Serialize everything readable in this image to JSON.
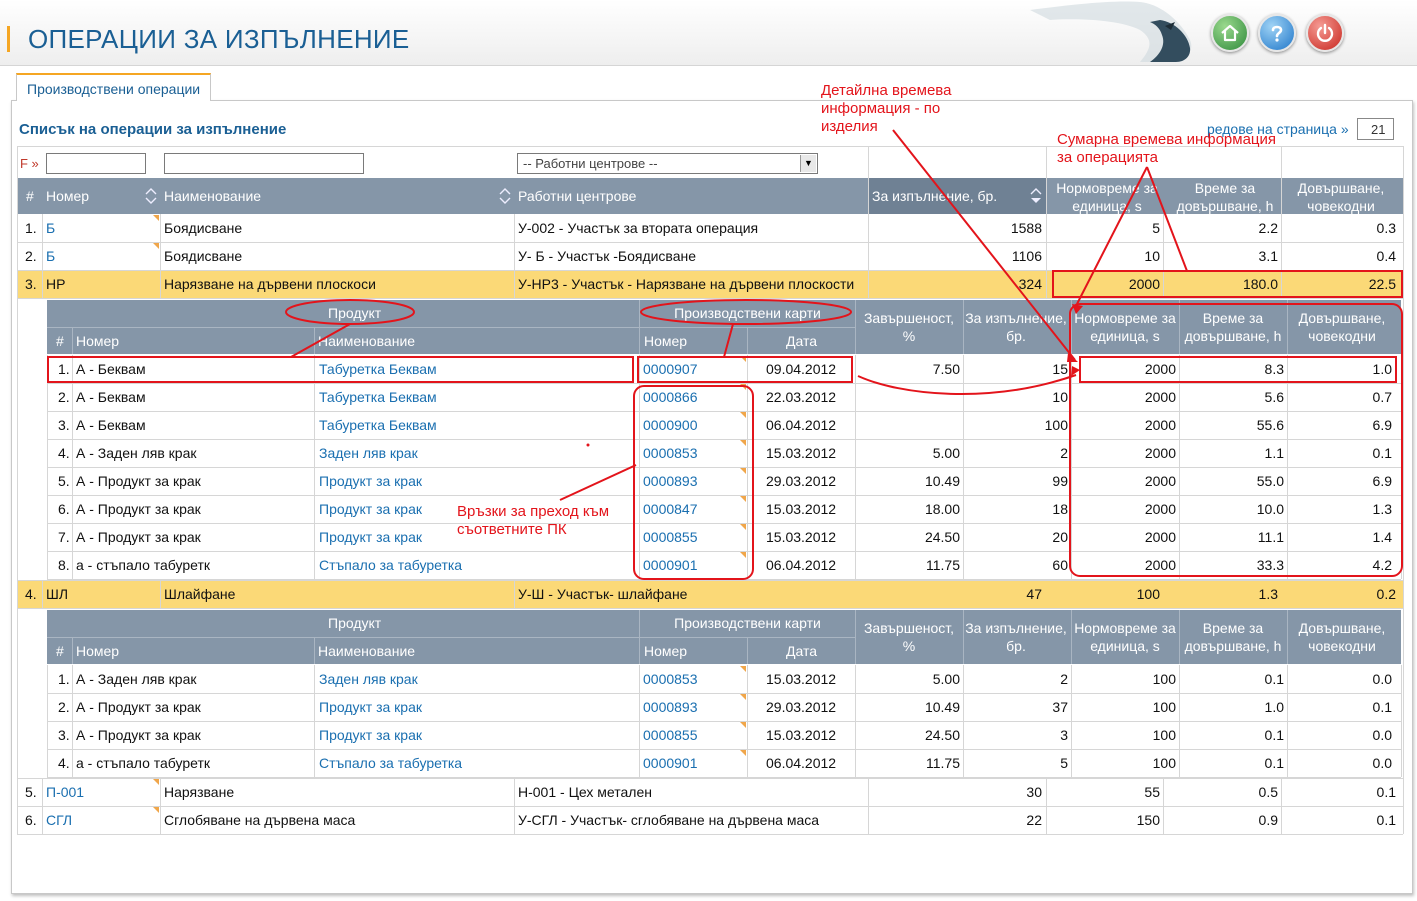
{
  "header": {
    "title": "ОПЕРАЦИИ ЗА ИЗПЪЛНЕНИЕ",
    "buttons": {
      "home": "home-icon",
      "help": "help-icon",
      "power": "power-icon"
    }
  },
  "tab": {
    "label": "Производствени операции"
  },
  "list": {
    "title": "Списък на операции за изпълнение",
    "rows_per_page_label": "редове на страница »",
    "rows_per_page_value": "21"
  },
  "filters": {
    "label": "F »",
    "number_value": "",
    "name_value": "",
    "work_center_selected": "-- Работни центрове --"
  },
  "main_columns": {
    "num": "#",
    "number": "Номер",
    "name": "Наименование",
    "work_centers": "Работни центрове",
    "to_execute": "За изпълнение, бр.",
    "norm_time": "Нормовреме за единица, s",
    "time_to_finish": "Време за довършване, h",
    "finish_mandays": "Довършване, човекодни"
  },
  "sub_columns": {
    "product": "Продукт",
    "production_cards": "Производствени карти",
    "num": "#",
    "number": "Номер",
    "name": "Наименование",
    "card_number": "Номер",
    "date": "Дата",
    "completion": "Завършеност, %",
    "to_execute": "За изпълнение, бр.",
    "norm_time": "Нормовреме за единица, s",
    "time_to_finish": "Време за довършване, h",
    "finish_mandays": "Довършване, човекодни"
  },
  "operations": [
    {
      "idx": "1.",
      "number": "Б",
      "name": "Боядисване",
      "work_center": "У-002 - Участък за втората операция",
      "to_execute": "1588",
      "norm": "5",
      "time": "2.2",
      "days": "0.3"
    },
    {
      "idx": "2.",
      "number": "Б",
      "name": "Боядисване",
      "work_center": "У- Б - Участък -Боядисване",
      "to_execute": "1106",
      "norm": "10",
      "time": "3.1",
      "days": "0.4"
    },
    {
      "idx": "3.",
      "number": "НР",
      "name": "Нарязване на дървени плоскоси",
      "work_center": "У-НР3 - Участък - Нарязване на дървени плоскости",
      "to_execute": "324",
      "norm": "2000",
      "time": "180.0",
      "days": "22.5"
    },
    {
      "idx": "4.",
      "number": "ШЛ",
      "name": "Шлайфане",
      "work_center": "У-Ш - Участък- шлайфане",
      "to_execute": "47",
      "norm": "100",
      "time": "1.3",
      "days": "0.2"
    },
    {
      "idx": "5.",
      "number": "П-001",
      "name": "Нарязване",
      "work_center": "Н-001 - Цех метален",
      "to_execute": "30",
      "norm": "55",
      "time": "0.5",
      "days": "0.1"
    },
    {
      "idx": "6.",
      "number": "СГЛ",
      "name": "Сглобяване на дървена маса",
      "work_center": "У-СГЛ - Участък- сглобяване на дървена маса",
      "to_execute": "22",
      "norm": "150",
      "time": "0.9",
      "days": "0.1"
    }
  ],
  "details_op3": [
    {
      "idx": "1.",
      "product_no": "А - Беквам",
      "product_name": "Табуретка Беквам",
      "card": "0000907",
      "date": "09.04.2012",
      "completion": "7.50",
      "qty": "15",
      "norm": "2000",
      "time": "8.3",
      "days": "1.0"
    },
    {
      "idx": "2.",
      "product_no": "А - Беквам",
      "product_name": "Табуретка Беквам",
      "card": "0000866",
      "date": "22.03.2012",
      "completion": "",
      "qty": "10",
      "norm": "2000",
      "time": "5.6",
      "days": "0.7"
    },
    {
      "idx": "3.",
      "product_no": "А - Беквам",
      "product_name": "Табуретка Беквам",
      "card": "0000900",
      "date": "06.04.2012",
      "completion": "",
      "qty": "100",
      "norm": "2000",
      "time": "55.6",
      "days": "6.9"
    },
    {
      "idx": "4.",
      "product_no": "А - Заден ляв крак",
      "product_name": "Заден ляв крак",
      "card": "0000853",
      "date": "15.03.2012",
      "completion": "5.00",
      "qty": "2",
      "norm": "2000",
      "time": "1.1",
      "days": "0.1"
    },
    {
      "idx": "5.",
      "product_no": "А - Продукт за крак",
      "product_name": "Продукт за крак",
      "card": "0000893",
      "date": "29.03.2012",
      "completion": "10.49",
      "qty": "99",
      "norm": "2000",
      "time": "55.0",
      "days": "6.9"
    },
    {
      "idx": "6.",
      "product_no": "А - Продукт за крак",
      "product_name": "Продукт за крак",
      "card": "0000847",
      "date": "15.03.2012",
      "completion": "18.00",
      "qty": "18",
      "norm": "2000",
      "time": "10.0",
      "days": "1.3"
    },
    {
      "idx": "7.",
      "product_no": "А - Продукт за крак",
      "product_name": "Продукт за крак",
      "card": "0000855",
      "date": "15.03.2012",
      "completion": "24.50",
      "qty": "20",
      "norm": "2000",
      "time": "11.1",
      "days": "1.4"
    },
    {
      "idx": "8.",
      "product_no": "а - стъпало табуретк",
      "product_name": "Стъпало за табуретка",
      "card": "0000901",
      "date": "06.04.2012",
      "completion": "11.75",
      "qty": "60",
      "norm": "2000",
      "time": "33.3",
      "days": "4.2"
    }
  ],
  "details_op4": [
    {
      "idx": "1.",
      "product_no": "А - Заден ляв крак",
      "product_name": "Заден ляв крак",
      "card": "0000853",
      "date": "15.03.2012",
      "completion": "5.00",
      "qty": "2",
      "norm": "100",
      "time": "0.1",
      "days": "0.0"
    },
    {
      "idx": "2.",
      "product_no": "А - Продукт за крак",
      "product_name": "Продукт за крак",
      "card": "0000893",
      "date": "29.03.2012",
      "completion": "10.49",
      "qty": "37",
      "norm": "100",
      "time": "1.0",
      "days": "0.1"
    },
    {
      "idx": "3.",
      "product_no": "А - Продукт за крак",
      "product_name": "Продукт за крак",
      "card": "0000855",
      "date": "15.03.2012",
      "completion": "24.50",
      "qty": "3",
      "norm": "100",
      "time": "0.1",
      "days": "0.0"
    },
    {
      "idx": "4.",
      "product_no": "а - стъпало табуретк",
      "product_name": "Стъпало за табуретка",
      "card": "0000901",
      "date": "06.04.2012",
      "completion": "11.75",
      "qty": "5",
      "norm": "100",
      "time": "0.1",
      "days": "0.0"
    }
  ],
  "annotations": {
    "detail_time": "Детайлна времева информация - по изделия",
    "summary_time": "Сумарна времева информация за операцията",
    "links": "Връзки за преход към съответните ПК"
  },
  "colors": {
    "header_gray": "#8596a8",
    "highlight_yellow": "#fbd977",
    "link_blue": "#1a6fb0",
    "title_blue": "#1a5f94",
    "annotation_red": "#e3141b",
    "tab_orange": "#f5a623"
  }
}
